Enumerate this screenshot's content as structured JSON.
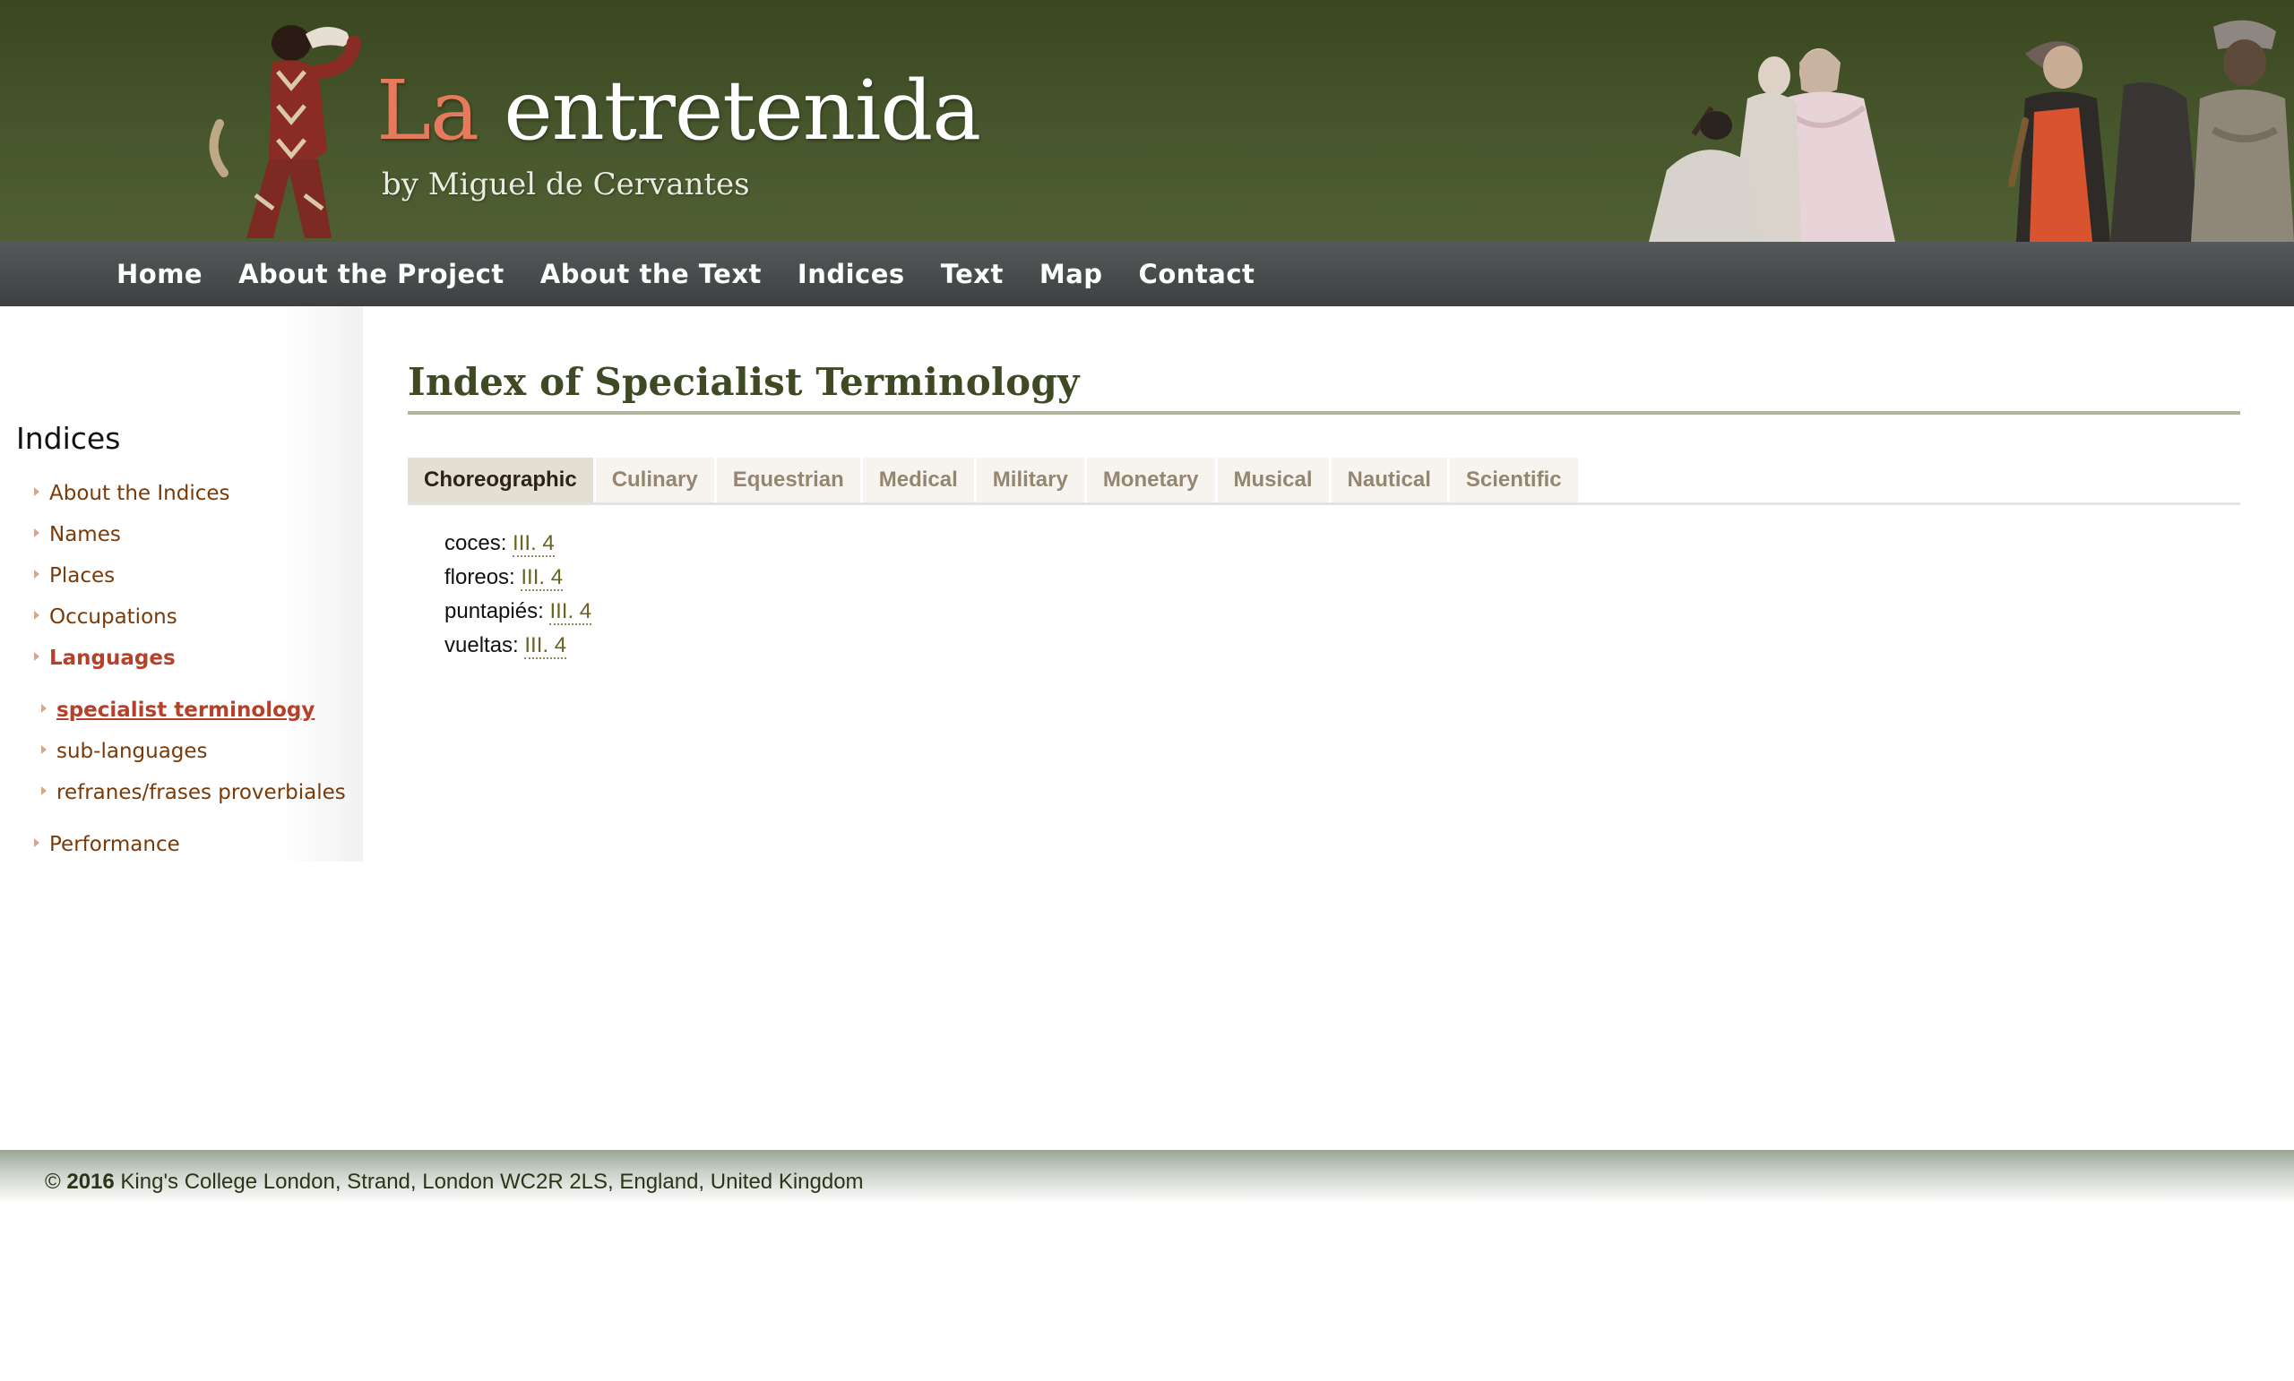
{
  "header": {
    "title_accent": "La",
    "title_rest": " entretenida",
    "subtitle": "by Miguel de Cervantes"
  },
  "nav": {
    "items": [
      {
        "label": "Home"
      },
      {
        "label": "About the Project"
      },
      {
        "label": "About the Text"
      },
      {
        "label": "Indices"
      },
      {
        "label": "Text"
      },
      {
        "label": "Map"
      },
      {
        "label": "Contact"
      }
    ]
  },
  "sidebar": {
    "title": "Indices",
    "items": [
      {
        "label": "About the Indices"
      },
      {
        "label": "Names"
      },
      {
        "label": "Places"
      },
      {
        "label": "Occupations"
      },
      {
        "label": "Languages"
      }
    ],
    "subitems": [
      {
        "label": "specialist terminology"
      },
      {
        "label": "sub-languages"
      },
      {
        "label": "refranes/frases proverbiales"
      }
    ],
    "last_item": {
      "label": "Performance"
    }
  },
  "main": {
    "title": "Index of Specialist Terminology",
    "tabs": [
      {
        "label": "Choreographic"
      },
      {
        "label": "Culinary"
      },
      {
        "label": "Equestrian"
      },
      {
        "label": "Medical"
      },
      {
        "label": "Military"
      },
      {
        "label": "Monetary"
      },
      {
        "label": "Musical"
      },
      {
        "label": "Nautical"
      },
      {
        "label": "Scientific"
      }
    ],
    "terms": [
      {
        "term": "coces:",
        "ref": "III. 4"
      },
      {
        "term": "floreos:",
        "ref": "III. 4"
      },
      {
        "term": "puntapiés:",
        "ref": "III. 4"
      },
      {
        "term": "vueltas:",
        "ref": "III. 4"
      }
    ]
  },
  "footer": {
    "copyright": "©",
    "year": "2016",
    "address": "King's College London, Strand, London WC2R 2LS, England, United Kingdom"
  }
}
